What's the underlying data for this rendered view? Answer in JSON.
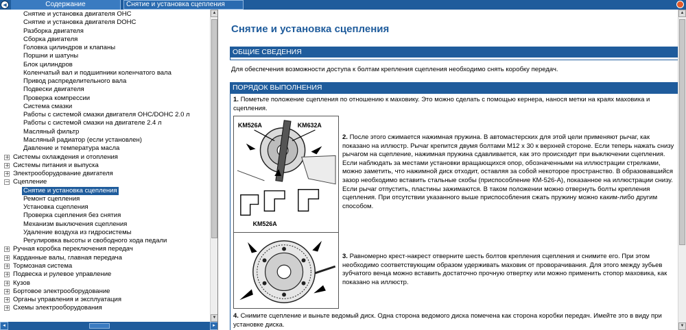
{
  "topbar": {
    "back_icon": "back-arrow-icon",
    "contents_tab": "Содержание",
    "topic_tab": "Снятие и установка сцепления",
    "colors": {
      "bar": "#1f5c9c",
      "tab": "#3a7bc1"
    }
  },
  "tree": [
    {
      "label": "Снятие и установка двигателя OHC",
      "level": 2
    },
    {
      "label": "Снятие и установка двигателя DOHC",
      "level": 2
    },
    {
      "label": "Разборка двигателя",
      "level": 2
    },
    {
      "label": "Сборка двигателя",
      "level": 2
    },
    {
      "label": "Головка цилиндров и клапаны",
      "level": 2
    },
    {
      "label": "Поршни и шатуны",
      "level": 2
    },
    {
      "label": "Блок цилиндров",
      "level": 2
    },
    {
      "label": "Коленчатый вал и подшипники коленчатого вала",
      "level": 2
    },
    {
      "label": "Привод распределительного вала",
      "level": 2
    },
    {
      "label": "Подвески двигателя",
      "level": 2
    },
    {
      "label": "Проверка компрессии",
      "level": 2
    },
    {
      "label": "Система смазки",
      "level": 2
    },
    {
      "label": "Работы с системой смазки двигателя OHC/DOHC  2.0 л",
      "level": 2
    },
    {
      "label": "Работы с системой смазки на двигателе  2.4 л",
      "level": 2
    },
    {
      "label": "Масляный фильтр",
      "level": 2
    },
    {
      "label": "Масляный радиатор (если установлен)",
      "level": 2
    },
    {
      "label": "Давление и температура масла",
      "level": 2
    },
    {
      "label": "Системы охлаждения и отопления",
      "level": 1,
      "toggle": "+"
    },
    {
      "label": "Системы питания и выпуска",
      "level": 1,
      "toggle": "+"
    },
    {
      "label": "Электрооборудование двигателя",
      "level": 1,
      "toggle": "+"
    },
    {
      "label": "Сцепление",
      "level": 1,
      "toggle": "−"
    },
    {
      "label": "Снятие и установка сцепления",
      "level": 2,
      "selected": true
    },
    {
      "label": "Ремонт сцепления",
      "level": 2
    },
    {
      "label": "Установка сцепления",
      "level": 2
    },
    {
      "label": "Проверка сцепления без снятия",
      "level": 2
    },
    {
      "label": "Механизм выключения сцепления",
      "level": 2
    },
    {
      "label": "Удаление воздуха из гидросистемы",
      "level": 2
    },
    {
      "label": "Регулировка высоты и свободного  хода педали",
      "level": 2
    },
    {
      "label": "Ручная коробка переключения передач",
      "level": 1,
      "toggle": "+"
    },
    {
      "label": "Карданные валы, главная передача",
      "level": 1,
      "toggle": "+"
    },
    {
      "label": "Тормозная система",
      "level": 1,
      "toggle": "+"
    },
    {
      "label": "Подвеска и рулевое управление",
      "level": 1,
      "toggle": "+"
    },
    {
      "label": "Кузов",
      "level": 1,
      "toggle": "+"
    },
    {
      "label": "Бортовое электрооборудование",
      "level": 1,
      "toggle": "+"
    },
    {
      "label": "Органы управления и эксплуатация",
      "level": 1,
      "toggle": "+"
    },
    {
      "label": "Схемы электрооборудования",
      "level": 1,
      "toggle": "+"
    }
  ],
  "doc": {
    "title": "Снятие и установка сцепления",
    "section1_header": "ОБЩИЕ СВЕДЕНИЯ",
    "intro": "Для обеспечения возможности доступа к болтам крепления сцепления необходимо снять коробку передач.",
    "section2_header": "ПОРЯДОК ВЫПОЛНЕНИЯ",
    "steps": [
      {
        "num": "1.",
        "text": " Пометьте положение сцепления по отношению к маховику. Это можно сделать с помощью кернера, нанося метки на краях маховика и сцепления."
      },
      {
        "num": "2.",
        "text": " После этого сжимается нажимная пружина. В автомастерских для этой цели применяют рычаг, как показано на иллюстр. Рычаг крепится двумя болтами М12 х 30 к верхней стороне. Если теперь нажать снизу рычагом на сцепление, нажимная пружина сдавливается, как это происходит при выключении сцепления. Если наблюдать за местами установки вращающихся опор, обозначенными на иллюстрации стрелками, можно заметить, что нажимной диск отходит, оставляя за собой некоторое пространство. В образовавшийся зазор необходимо вставить стальные скобы (приспособление КМ-526-А), показанное на иллюстрации снизу. Если рычаг отпустить, пластины зажимаются. В таком положении можно отвернуть болты крепления сцепления. При отсутствии указанного выше приспособления сжать пружину можно каким-либо другим способом."
      },
      {
        "num": "3.",
        "text": " Равномерно крест-накрест отверните шесть болтов крепления сцепления и снимите его. При этом необходимо соответствующим образом удерживать маховик от проворачивания. Для этого между зубьев зубчатого венца можно вставить достаточно прочную отвертку или можно применить стопор маховика, как показано на иллюстр."
      },
      {
        "num": "4.",
        "text": " Снимите сцепление и выньте ведомый диск. Одна сторона ведомого диска помечена как сторона коробки передач. Имейте это в виду при установке диска."
      }
    ],
    "figure1_labels": [
      "KM526A",
      "KM632A",
      "KM526A"
    ]
  }
}
